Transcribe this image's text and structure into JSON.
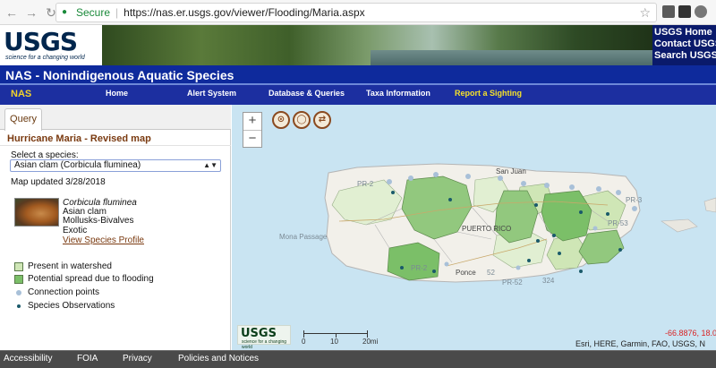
{
  "browser": {
    "secure_label": "Secure",
    "url": "https://nas.er.usgs.gov/viewer/Flooding/Maria.aspx"
  },
  "banner": {
    "logo": "USGS",
    "tagline": "science for a changing world",
    "links": [
      "USGS Home",
      "Contact USGS",
      "Search USGS"
    ]
  },
  "site_title": "NAS - Nonindigenous Aquatic Species",
  "nav": {
    "logo_text": "NAS",
    "items": [
      "Home",
      "Alert System",
      "Database & Queries",
      "Taxa Information",
      "Report a Sighting"
    ]
  },
  "panel": {
    "tab": "Query",
    "title": "Hurricane Maria - Revised map",
    "select_label": "Select a species:",
    "select_value": "Asian clam (Corbicula fluminea)",
    "updated": "Map updated 3/28/2018",
    "species": {
      "scientific": "Corbicula fluminea",
      "common": "Asian clam",
      "group": "Mollusks-Bivalves",
      "status": "Exotic",
      "profile_link": "View Species Profile"
    },
    "legend": {
      "present": "Present in watershed",
      "potential": "Potential spread due to flooding",
      "connection": "Connection points",
      "observations": "Species Observations"
    },
    "colors": {
      "present": "#cfe6b6",
      "potential": "#7bbf68",
      "connection": "#a8c0d8",
      "observations": "#1a5a6a"
    }
  },
  "map": {
    "labels": {
      "san_juan": "San Juan",
      "mona": "Mona Passage",
      "puerto_rico": "PUERTO RICO",
      "ponce": "Ponce"
    },
    "road_labels": [
      "PR-2",
      "PR-2",
      "52",
      "PR-52",
      "PR-53",
      "PR-3",
      "324"
    ],
    "scale": {
      "labels": [
        "0",
        "10",
        "20mi"
      ]
    },
    "coordinate": "-66.8876, 18.0",
    "attribution": "Esri, HERE, Garmin, FAO, USGS, N",
    "logo": "USGS",
    "logo_tagline": "science for a changing world"
  },
  "footer": [
    "Accessibility",
    "FOIA",
    "Privacy",
    "Policies and Notices"
  ]
}
